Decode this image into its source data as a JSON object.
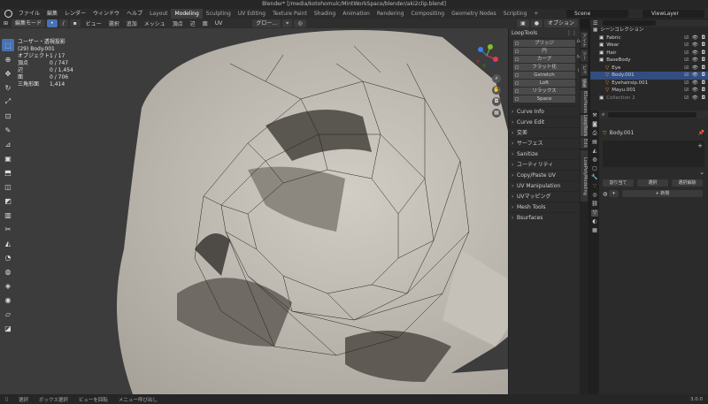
{
  "window": {
    "title": "Blender* [/media/kotohomulc/MintWorkSpace/blender/aki2clip.blend]"
  },
  "menu": {
    "items": [
      "ファイル",
      "編集",
      "レンダー",
      "ウィンドウ",
      "ヘルプ"
    ]
  },
  "workspaces": [
    "Layout",
    "Modeling",
    "Sculpting",
    "UV Editing",
    "Texture Paint",
    "Shading",
    "Animation",
    "Rendering",
    "Compositing",
    "Geometry Nodes",
    "Scripting",
    "+"
  ],
  "active_workspace": "Modeling",
  "scene": "Scene",
  "view_layer": "ViewLayer",
  "header": {
    "mode": "編集モード",
    "items": [
      "ビュー",
      "選択",
      "追加",
      "メッシュ",
      "頂点",
      "辺",
      "面",
      "UV"
    ],
    "transform": "グロー...",
    "options": "オプション"
  },
  "overlay": {
    "view_name": "ユーザー・透視投影",
    "object_name": "(29) Body.001",
    "stats": [
      {
        "k": "オブジェクト",
        "v": "1 / 17"
      },
      {
        "k": "頂点",
        "v": "0 / 747"
      },
      {
        "k": "辺",
        "v": "0 / 1,454"
      },
      {
        "k": "面",
        "v": "0 / 706"
      },
      {
        "k": "三角形面",
        "v": "1,414"
      }
    ]
  },
  "npanel": {
    "loop_header": "LoopTools",
    "loop_buttons": [
      "ブリッジ",
      "円",
      "カーブ",
      "フラット化",
      "Gstretch",
      "Loft",
      "リラックス",
      "Space"
    ],
    "sections": [
      "Curve Info",
      "Curve Edit",
      "交差",
      "サーフェス",
      "Sanitize",
      "ユーティリティ",
      "Copy/Paste UV",
      "UV Manipulation",
      "UVマッピング",
      "Mesh Tools",
      "Bsurfaces"
    ],
    "tabs": [
      "アイテム",
      "ツール",
      "ビュー",
      "編集",
      "BSurfaces",
      "LoopTools",
      "Edit",
      "LowPolyModeling"
    ]
  },
  "outliner": {
    "rows": [
      {
        "label": "シーンコレクション",
        "indent": 0,
        "sel": false
      },
      {
        "label": "Fabric",
        "indent": 1,
        "sel": false
      },
      {
        "label": "Wear",
        "indent": 1,
        "sel": false
      },
      {
        "label": "Hair",
        "indent": 1,
        "sel": false
      },
      {
        "label": "BaseBody",
        "indent": 1,
        "sel": false
      },
      {
        "label": "Eye",
        "indent": 2,
        "sel": false
      },
      {
        "label": "Body.001",
        "indent": 2,
        "sel": true
      },
      {
        "label": "Eyehairsip.001",
        "indent": 2,
        "sel": false
      },
      {
        "label": "Mayu.001",
        "indent": 2,
        "sel": false
      },
      {
        "label": "Collection 2",
        "indent": 1,
        "sel": false
      }
    ]
  },
  "properties": {
    "object": "Body.001",
    "buttons": [
      "割り当て",
      "選択",
      "選択解除"
    ],
    "new_label": "新規"
  },
  "statusbar": {
    "items": [
      "選択",
      "ボックス選択",
      "ビューを回転",
      "メニュー呼び出し"
    ],
    "version": "3.0.0"
  },
  "colors": {
    "accent": "#4772b3",
    "selected_row": "#334d80",
    "axis_x": "#e8394c",
    "axis_y": "#7ec12a",
    "axis_z": "#3c82e6"
  }
}
